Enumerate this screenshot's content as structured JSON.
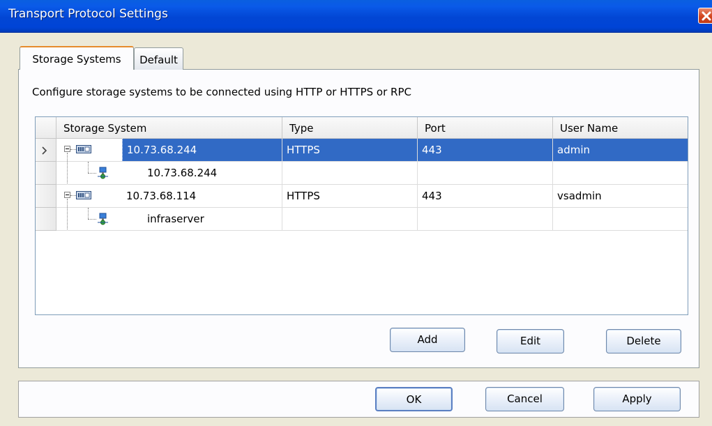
{
  "window": {
    "title": "Transport Protocol Settings"
  },
  "tabs": [
    {
      "label": "Storage Systems",
      "active": true
    },
    {
      "label": "Default",
      "active": false
    }
  ],
  "description": "Configure storage systems to be connected using  HTTP or HTTPS or RPC",
  "grid": {
    "columns": [
      "Storage System",
      "Type",
      "Port",
      "User Name"
    ],
    "rows": [
      {
        "name": "10.73.68.244",
        "type": "HTTPS",
        "port": "443",
        "user": "admin",
        "selected": true
      },
      {
        "name": "10.73.68.244",
        "type": "",
        "port": "",
        "user": ""
      },
      {
        "name": "10.73.68.114",
        "type": "HTTPS",
        "port": "443",
        "user": "vsadmin"
      },
      {
        "name": "infraserver",
        "type": "",
        "port": "",
        "user": ""
      }
    ],
    "row_indicator": ">"
  },
  "panel_buttons": {
    "add": "Add",
    "edit": "Edit",
    "delete": "Delete"
  },
  "dialog_buttons": {
    "ok": "OK",
    "cancel": "Cancel",
    "apply": "Apply"
  },
  "colors": {
    "selection": "#316ac5",
    "titlebar": "#0846d8",
    "active_tab_accent": "#e68b2c"
  },
  "icons": [
    "close-icon",
    "collapse-icon",
    "storage-system-icon",
    "network-host-icon",
    "row-pointer-icon"
  ]
}
